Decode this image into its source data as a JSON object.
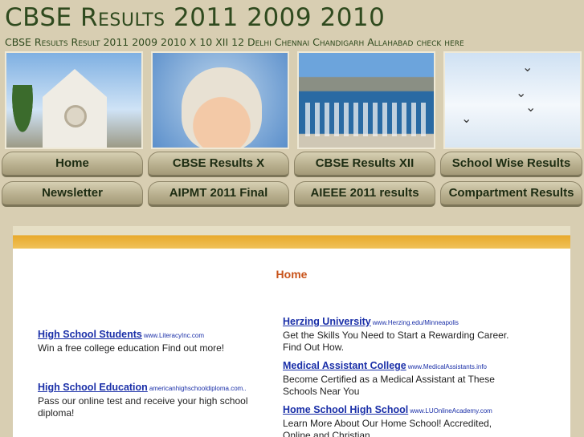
{
  "header": {
    "title": "CBSE Results 2011 2009 2010",
    "subtitle": "CBSE Results Result 2011 2009 2010 X  10 XII 12 Delhi Chennai Chandigarh Allahabad check here"
  },
  "nav": {
    "row1": [
      "Home",
      "CBSE Results X",
      "CBSE Results XII",
      "School Wise Results"
    ],
    "row2": [
      "Newsletter",
      "AIPMT 2011 Final",
      "AIEEE 2011 results",
      "Compartment Results"
    ]
  },
  "main": {
    "page_title": "Home"
  },
  "ads_left": [
    {
      "title": "High School Students",
      "url": "www.LiteracyInc.com",
      "desc": "Win a free college education Find out more!"
    },
    {
      "title": "High School Education",
      "url": "americanhighschooldiploma.com..",
      "desc": "Pass our online test and receive your high school diploma!"
    }
  ],
  "ads_right": [
    {
      "title": "Herzing University",
      "url": "www.Herzing.edu/Minneapolis",
      "desc": "Get the Skills You Need to Start a Rewarding Career. Find Out How."
    },
    {
      "title": "Medical Assistant College",
      "url": "www.MedicalAssistants.info",
      "desc": "Become Certified as a Medical Assistant at These Schools Near You"
    },
    {
      "title": "Home School High School",
      "url": "www.LUOnlineAcademy.com",
      "desc": "Learn More About Our Home School! Accredited, Online and Christian."
    }
  ],
  "colors": {
    "background": "#d8ceb2",
    "title": "#2f4a1e",
    "accent_bar": "#e8a92b",
    "link": "#1a2fa8",
    "page_title": "#c8531a"
  }
}
